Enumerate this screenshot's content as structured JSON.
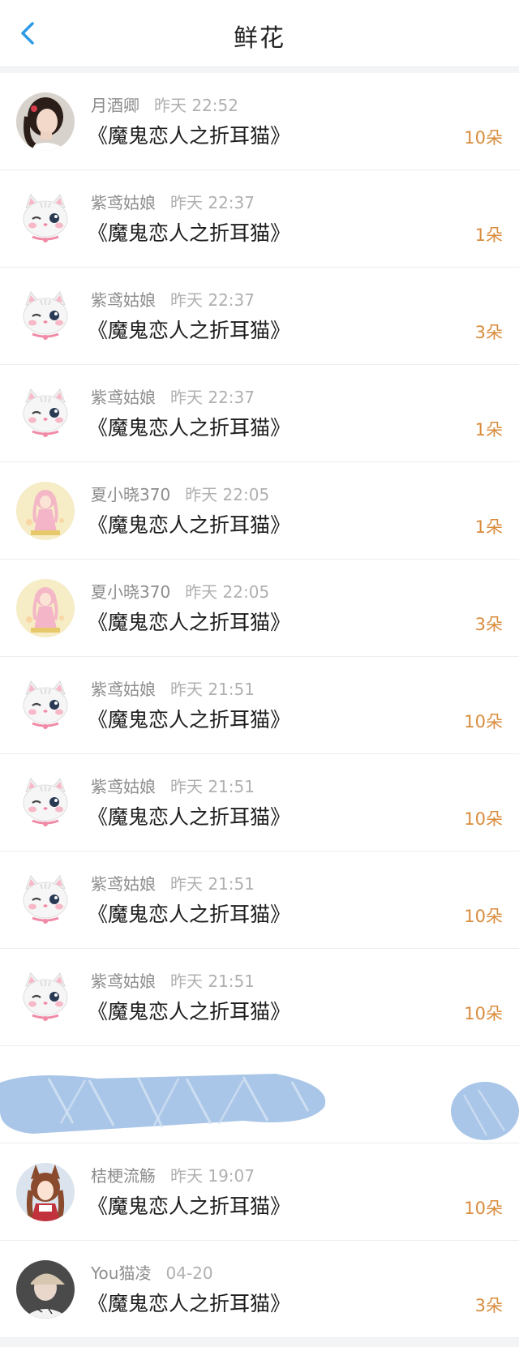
{
  "header": {
    "title": "鲜花"
  },
  "rows": [
    {
      "name": "月酒卿",
      "time": "昨天 22:52",
      "book": "《魔鬼恋人之折耳猫》",
      "count": "10朵",
      "avatar": "photo-girl"
    },
    {
      "name": "紫鸢姑娘",
      "time": "昨天 22:37",
      "book": "《魔鬼恋人之折耳猫》",
      "count": "1朵",
      "avatar": "cat"
    },
    {
      "name": "紫鸢姑娘",
      "time": "昨天 22:37",
      "book": "《魔鬼恋人之折耳猫》",
      "count": "3朵",
      "avatar": "cat"
    },
    {
      "name": "紫鸢姑娘",
      "time": "昨天 22:37",
      "book": "《魔鬼恋人之折耳猫》",
      "count": "1朵",
      "avatar": "cat"
    },
    {
      "name": "夏小晓370",
      "time": "昨天 22:05",
      "book": "《魔鬼恋人之折耳猫》",
      "count": "1朵",
      "avatar": "anime-pink"
    },
    {
      "name": "夏小晓370",
      "time": "昨天 22:05",
      "book": "《魔鬼恋人之折耳猫》",
      "count": "3朵",
      "avatar": "anime-pink"
    },
    {
      "name": "紫鸢姑娘",
      "time": "昨天 21:51",
      "book": "《魔鬼恋人之折耳猫》",
      "count": "10朵",
      "avatar": "cat"
    },
    {
      "name": "紫鸢姑娘",
      "time": "昨天 21:51",
      "book": "《魔鬼恋人之折耳猫》",
      "count": "10朵",
      "avatar": "cat"
    },
    {
      "name": "紫鸢姑娘",
      "time": "昨天 21:51",
      "book": "《魔鬼恋人之折耳猫》",
      "count": "10朵",
      "avatar": "cat"
    },
    {
      "name": "紫鸢姑娘",
      "time": "昨天 21:51",
      "book": "《魔鬼恋人之折耳猫》",
      "count": "10朵",
      "avatar": "cat"
    },
    {
      "redacted": true
    },
    {
      "name": "桔梗流觞",
      "time": "昨天 19:07",
      "book": "《魔鬼恋人之折耳猫》",
      "count": "10朵",
      "avatar": "anime-fox"
    },
    {
      "name": "You猫凌",
      "time": "04-20",
      "book": "《魔鬼恋人之折耳猫》",
      "count": "3朵",
      "avatar": "photo-cap"
    }
  ],
  "colors": {
    "back_icon": "#2f9be6",
    "count": "#d98c3d",
    "redaction": "#a9c6e8"
  }
}
